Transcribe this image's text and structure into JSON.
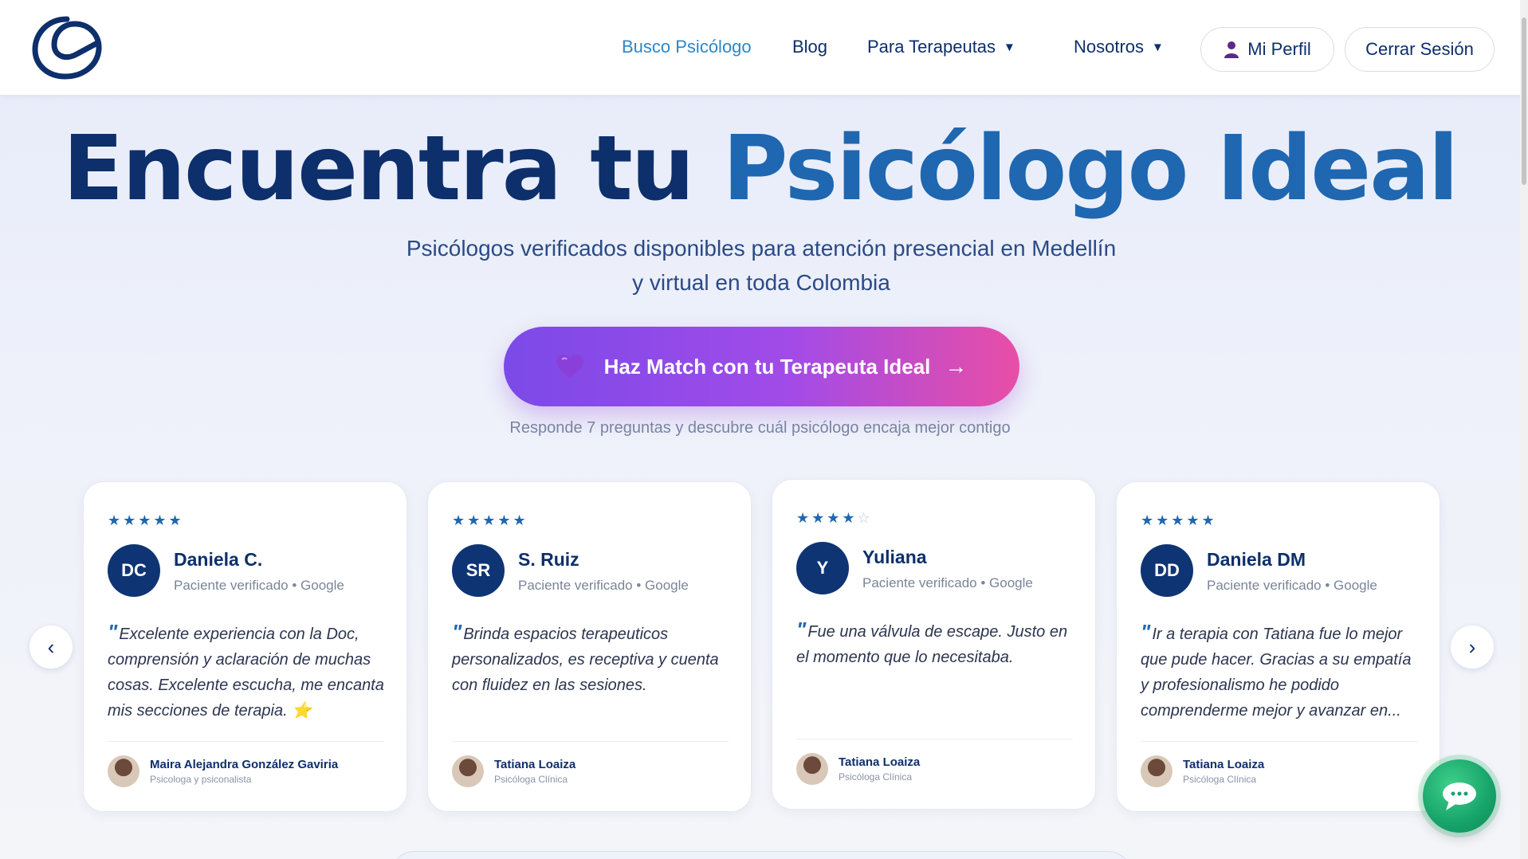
{
  "header": {
    "nav": {
      "busco": "Busco Psicólogo",
      "blog": "Blog",
      "terapeutas": "Para Terapeutas",
      "nosotros": "Nosotros",
      "caret": "▼"
    },
    "profile_label": "Mi Perfil",
    "logout_label": "Cerrar Sesión"
  },
  "hero": {
    "title_part1": "Encuentra tu",
    "title_part2": "Psicólogo Ideal",
    "subtitle": "Psicólogos verificados disponibles para atención presencial en Medellín y virtual en toda Colombia",
    "cta_label": "Haz Match con tu Terapeuta Ideal",
    "cta_arrow": "→",
    "cta_note": "Responde 7 preguntas y descubre cuál psicólogo encaja mejor contigo"
  },
  "carousel": {
    "prev": "‹",
    "next": "›",
    "cards": [
      {
        "rating": 5,
        "stars_filled": "★★★★★",
        "stars_empty": "",
        "initials": "DC",
        "name": "Daniela C.",
        "meta": "Paciente verificado • Google",
        "quote_mark": "\"",
        "text": "Excelente experiencia con la Doc, comprensión y aclaración de muchas cosas. Excelente escucha, me encanta mis secciones de terapia. ⭐",
        "therapist": "Maira Alejandra González Gaviria",
        "role": "Psicologa y psiconalista"
      },
      {
        "rating": 5,
        "stars_filled": "★★★★★",
        "stars_empty": "",
        "initials": "SR",
        "name": "S. Ruiz",
        "meta": "Paciente verificado • Google",
        "quote_mark": "\"",
        "text": "Brinda espacios terapeuticos personalizados, es receptiva y cuenta con fluidez en las sesiones.",
        "therapist": "Tatiana Loaiza",
        "role": "Psicóloga Clínica"
      },
      {
        "rating": 4,
        "stars_filled": "★★★★",
        "stars_empty": "☆",
        "initials": "Y",
        "name": "Yuliana",
        "meta": "Paciente verificado • Google",
        "quote_mark": "\"",
        "text": "Fue una válvula de escape. Justo en el momento que lo necesitaba.",
        "therapist": "Tatiana Loaiza",
        "role": "Psicóloga Clínica"
      },
      {
        "rating": 5,
        "stars_filled": "★★★★★",
        "stars_empty": "",
        "initials": "DD",
        "name": "Daniela DM",
        "meta": "Paciente verificado • Google",
        "quote_mark": "\"",
        "text": "Ir a terapia con Tatiana fue lo mejor que pude hacer. Gracias a su empatía y profesionalismo he podido comprenderme mejor y avanzar en...",
        "therapist": "Tatiana Loaiza",
        "role": "Psicóloga Clínica"
      }
    ]
  },
  "colors": {
    "brand_dark": "#0d2f6b",
    "brand_light": "#1f67b0",
    "nav_active": "#2f86c6",
    "cta_start": "#7b4ae8",
    "cta_end": "#e84ea6",
    "chat_green": "#16a36a"
  },
  "icons": {
    "logo": "e-swirl-logo",
    "profile": "user-icon",
    "cta": "purple-heart-icon",
    "chat": "chat-bubble-icon"
  }
}
